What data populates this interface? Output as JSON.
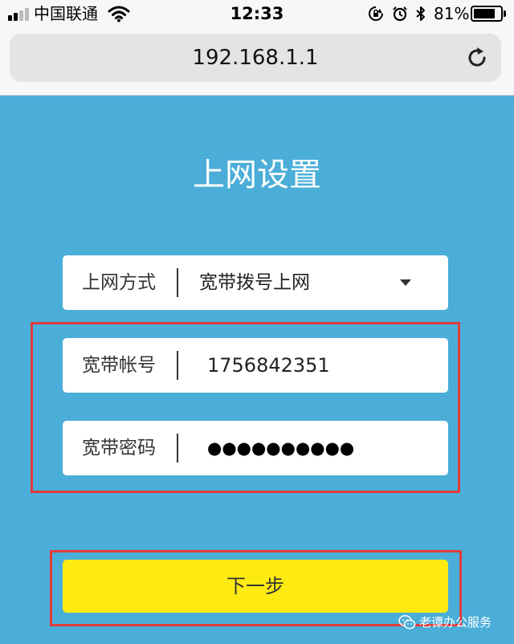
{
  "status_bar": {
    "carrier": "中国联通",
    "time": "12:33",
    "battery_percent_text": "81%",
    "battery_level": 0.81,
    "signal_bars_filled": 2,
    "signal_bars_total": 4,
    "icons": [
      "signal-icon",
      "wifi-icon",
      "orientation-lock-icon",
      "alarm-icon",
      "bluetooth-icon",
      "battery-icon"
    ]
  },
  "browser": {
    "url": "192.168.1.1",
    "reload_icon": "reload-icon"
  },
  "page": {
    "title": "上网设置",
    "background_color": "#4aaed8",
    "fields": [
      {
        "label": "上网方式",
        "value": "宽带拨号上网",
        "type": "select"
      },
      {
        "label": "宽带帐号",
        "value": "1756842351",
        "type": "text"
      },
      {
        "label": "宽带密码",
        "value": "●●●●●●●●●●",
        "type": "password"
      }
    ],
    "next_button": "下一步",
    "button_color": "#ffeb12",
    "highlight_color": "#e23b3b"
  },
  "watermark": {
    "text": "老谭办公服务",
    "icon": "wechat-icon"
  }
}
